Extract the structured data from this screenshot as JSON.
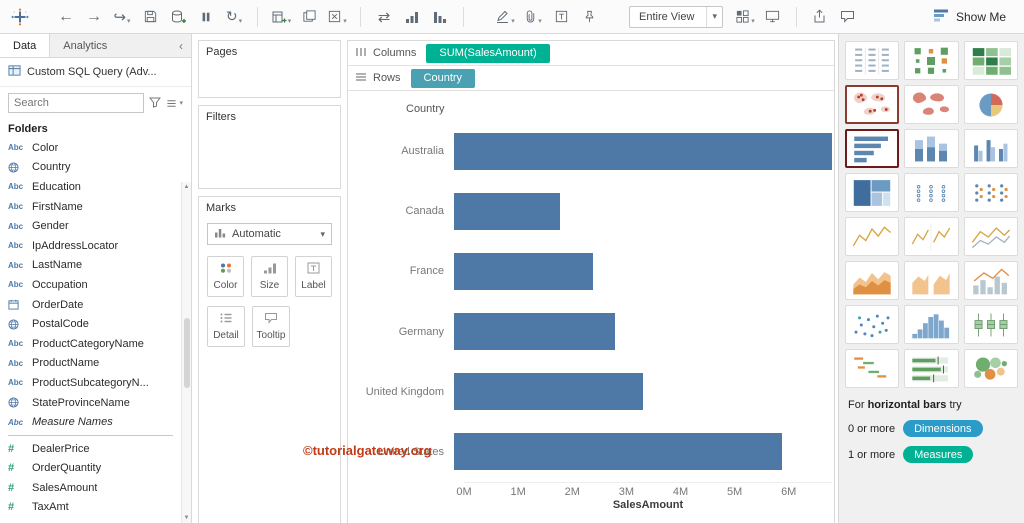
{
  "toolbar": {
    "entire_view_label": "Entire View",
    "show_me_label": "Show Me"
  },
  "sidebar": {
    "tabs": [
      {
        "label": "Data"
      },
      {
        "label": "Analytics"
      }
    ],
    "datasource": "Custom SQL Query (Adv...",
    "search_placeholder": "Search",
    "folders_label": "Folders",
    "fields": [
      {
        "label": "Color",
        "icon": "abc"
      },
      {
        "label": "Country",
        "icon": "globe"
      },
      {
        "label": "Education",
        "icon": "abc"
      },
      {
        "label": "FirstName",
        "icon": "abc"
      },
      {
        "label": "Gender",
        "icon": "abc"
      },
      {
        "label": "IpAddressLocator",
        "icon": "abc"
      },
      {
        "label": "LastName",
        "icon": "abc"
      },
      {
        "label": "Occupation",
        "icon": "abc"
      },
      {
        "label": "OrderDate",
        "icon": "calendar"
      },
      {
        "label": "PostalCode",
        "icon": "globe"
      },
      {
        "label": "ProductCategoryName",
        "icon": "abc"
      },
      {
        "label": "ProductName",
        "icon": "abc"
      },
      {
        "label": "ProductSubcategoryN...",
        "icon": "abc"
      },
      {
        "label": "StateProvinceName",
        "icon": "globe"
      },
      {
        "label": "Measure Names",
        "icon": "abc-italic",
        "italic": true
      },
      {
        "label": "DealerPrice",
        "icon": "hash",
        "divider_before": true
      },
      {
        "label": "OrderQuantity",
        "icon": "hash"
      },
      {
        "label": "SalesAmount",
        "icon": "hash"
      },
      {
        "label": "TaxAmt",
        "icon": "hash"
      }
    ]
  },
  "cards": {
    "pages_label": "Pages",
    "filters_label": "Filters",
    "marks": {
      "label": "Marks",
      "mark_type": "Automatic",
      "buttons": [
        "Color",
        "Size",
        "Label",
        "Detail",
        "Tooltip"
      ]
    }
  },
  "shelves": {
    "columns_label": "Columns",
    "rows_label": "Rows",
    "columns_pill": "SUM(SalesAmount)",
    "rows_pill": "Country"
  },
  "chart_data": {
    "type": "bar",
    "orientation": "horizontal",
    "title": "Country",
    "categories": [
      "Australia",
      "Canada",
      "France",
      "Germany",
      "United Kingdom",
      "United States"
    ],
    "values": [
      6.8,
      1.9,
      2.5,
      2.9,
      3.4,
      5.9
    ],
    "value_unit": "M",
    "xlabel": "SalesAmount",
    "x_ticks": [
      "0M",
      "1M",
      "2M",
      "3M",
      "4M",
      "5M",
      "6M"
    ],
    "xlim": [
      0,
      6.8
    ],
    "bar_color": "#4e79a7",
    "grid": false,
    "legend": false
  },
  "watermark": "©tutorialgateway.org",
  "colors": {
    "columns_pill_color": "#00b294",
    "rows_pill_color": "#4aa1b2",
    "dimensions_pill_color": "#2b9cc7",
    "measures_pill_color": "#00b294"
  },
  "showme": {
    "hint_prefix": "For ",
    "hint_bold": "horizontal bars",
    "hint_suffix": " try",
    "dim_text": "0 or more",
    "dim_pill": "Dimensions",
    "measure_text": "1 or more",
    "measure_pill": "Measures",
    "types": [
      {
        "name": "text-table"
      },
      {
        "name": "heat-map"
      },
      {
        "name": "highlight-table"
      },
      {
        "name": "symbol-map",
        "outlined": true
      },
      {
        "name": "filled-map"
      },
      {
        "name": "pie-chart"
      },
      {
        "name": "horizontal-bars",
        "selected": true
      },
      {
        "name": "stacked-bars"
      },
      {
        "name": "side-by-side-bars"
      },
      {
        "name": "treemap"
      },
      {
        "name": "circle-views"
      },
      {
        "name": "side-by-side-circles"
      },
      {
        "name": "continuous-lines"
      },
      {
        "name": "discrete-lines"
      },
      {
        "name": "dual-lines"
      },
      {
        "name": "continuous-area"
      },
      {
        "name": "discrete-area"
      },
      {
        "name": "dual-combination"
      },
      {
        "name": "scatter-plot"
      },
      {
        "name": "histogram"
      },
      {
        "name": "box-and-whisker"
      },
      {
        "name": "gantt"
      },
      {
        "name": "bullet-graph"
      },
      {
        "name": "packed-bubbles"
      }
    ]
  }
}
